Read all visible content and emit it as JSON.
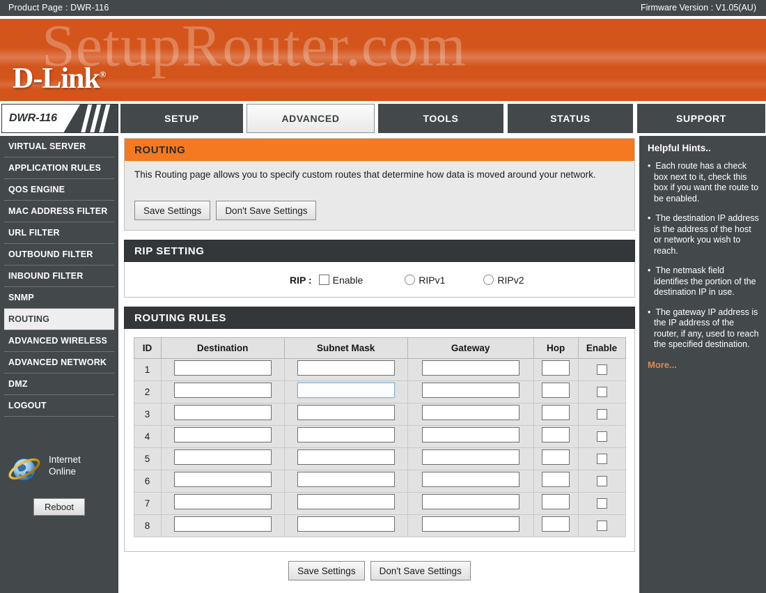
{
  "topbar": {
    "product_label": "Product Page :  DWR-116",
    "firmware_label": "Firmware Version : V1.05(AU)"
  },
  "banner": {
    "logo": "D-Link",
    "logo_reg": "®",
    "watermark": "SetupRouter.com"
  },
  "nav": {
    "model": "DWR-116",
    "tabs": [
      {
        "label": "SETUP",
        "active": false
      },
      {
        "label": "ADVANCED",
        "active": true
      },
      {
        "label": "TOOLS",
        "active": false
      },
      {
        "label": "STATUS",
        "active": false
      },
      {
        "label": "SUPPORT",
        "active": false
      }
    ]
  },
  "sidebar": {
    "items": [
      {
        "label": "VIRTUAL SERVER",
        "active": false
      },
      {
        "label": "APPLICATION RULES",
        "active": false
      },
      {
        "label": "QOS ENGINE",
        "active": false
      },
      {
        "label": "MAC ADDRESS FILTER",
        "active": false
      },
      {
        "label": "URL FILTER",
        "active": false
      },
      {
        "label": "OUTBOUND FILTER",
        "active": false
      },
      {
        "label": "INBOUND FILTER",
        "active": false
      },
      {
        "label": "SNMP",
        "active": false
      },
      {
        "label": "ROUTING",
        "active": true
      },
      {
        "label": "ADVANCED WIRELESS",
        "active": false
      },
      {
        "label": "ADVANCED NETWORK",
        "active": false
      },
      {
        "label": "DMZ",
        "active": false
      },
      {
        "label": "LOGOUT",
        "active": false
      }
    ],
    "status_line1": "Internet",
    "status_line2": "Online",
    "reboot_label": "Reboot"
  },
  "routing": {
    "header": "ROUTING",
    "description": "This Routing page allows you to specify custom routes that determine how data is moved around your network.",
    "save_label": "Save Settings",
    "dont_save_label": "Don't Save Settings"
  },
  "rip": {
    "header": "RIP SETTING",
    "label": "RIP :",
    "enable_label": "Enable",
    "enable_checked": false,
    "v1_label": "RIPv1",
    "v1_selected": false,
    "v2_label": "RIPv2",
    "v2_selected": false
  },
  "rules": {
    "header": "ROUTING RULES",
    "columns": [
      "ID",
      "Destination",
      "Subnet Mask",
      "Gateway",
      "Hop",
      "Enable"
    ],
    "rows": [
      {
        "id": "1",
        "destination": "",
        "subnet_mask": "",
        "gateway": "",
        "hop": "",
        "enable": false
      },
      {
        "id": "2",
        "destination": "",
        "subnet_mask": "",
        "gateway": "",
        "hop": "",
        "enable": false
      },
      {
        "id": "3",
        "destination": "",
        "subnet_mask": "",
        "gateway": "",
        "hop": "",
        "enable": false
      },
      {
        "id": "4",
        "destination": "",
        "subnet_mask": "",
        "gateway": "",
        "hop": "",
        "enable": false
      },
      {
        "id": "5",
        "destination": "",
        "subnet_mask": "",
        "gateway": "",
        "hop": "",
        "enable": false
      },
      {
        "id": "6",
        "destination": "",
        "subnet_mask": "",
        "gateway": "",
        "hop": "",
        "enable": false
      },
      {
        "id": "7",
        "destination": "",
        "subnet_mask": "",
        "gateway": "",
        "hop": "",
        "enable": false
      },
      {
        "id": "8",
        "destination": "",
        "subnet_mask": "",
        "gateway": "",
        "hop": "",
        "enable": false
      }
    ],
    "focused_cell": {
      "row": 2,
      "column": "subnet_mask"
    }
  },
  "footer": {
    "save_label": "Save Settings",
    "dont_save_label": "Don't Save Settings"
  },
  "hints": {
    "title": "Helpful Hints..",
    "items": [
      "Each route has a check box next to it, check this box if you want the route to be enabled.",
      "The destination IP address is the address of the host or network you wish to reach.",
      "The netmask field identifies the portion of the destination IP in use.",
      "The gateway IP address is the IP address of the router, if any, used to reach the specified destination."
    ],
    "more_label": "More..."
  },
  "colors": {
    "orange_header": "#f57920",
    "dark_header": "#333739",
    "panel_dark": "#43484a",
    "more_link": "#e08a4a",
    "focus_border": "#7fb3d8"
  }
}
